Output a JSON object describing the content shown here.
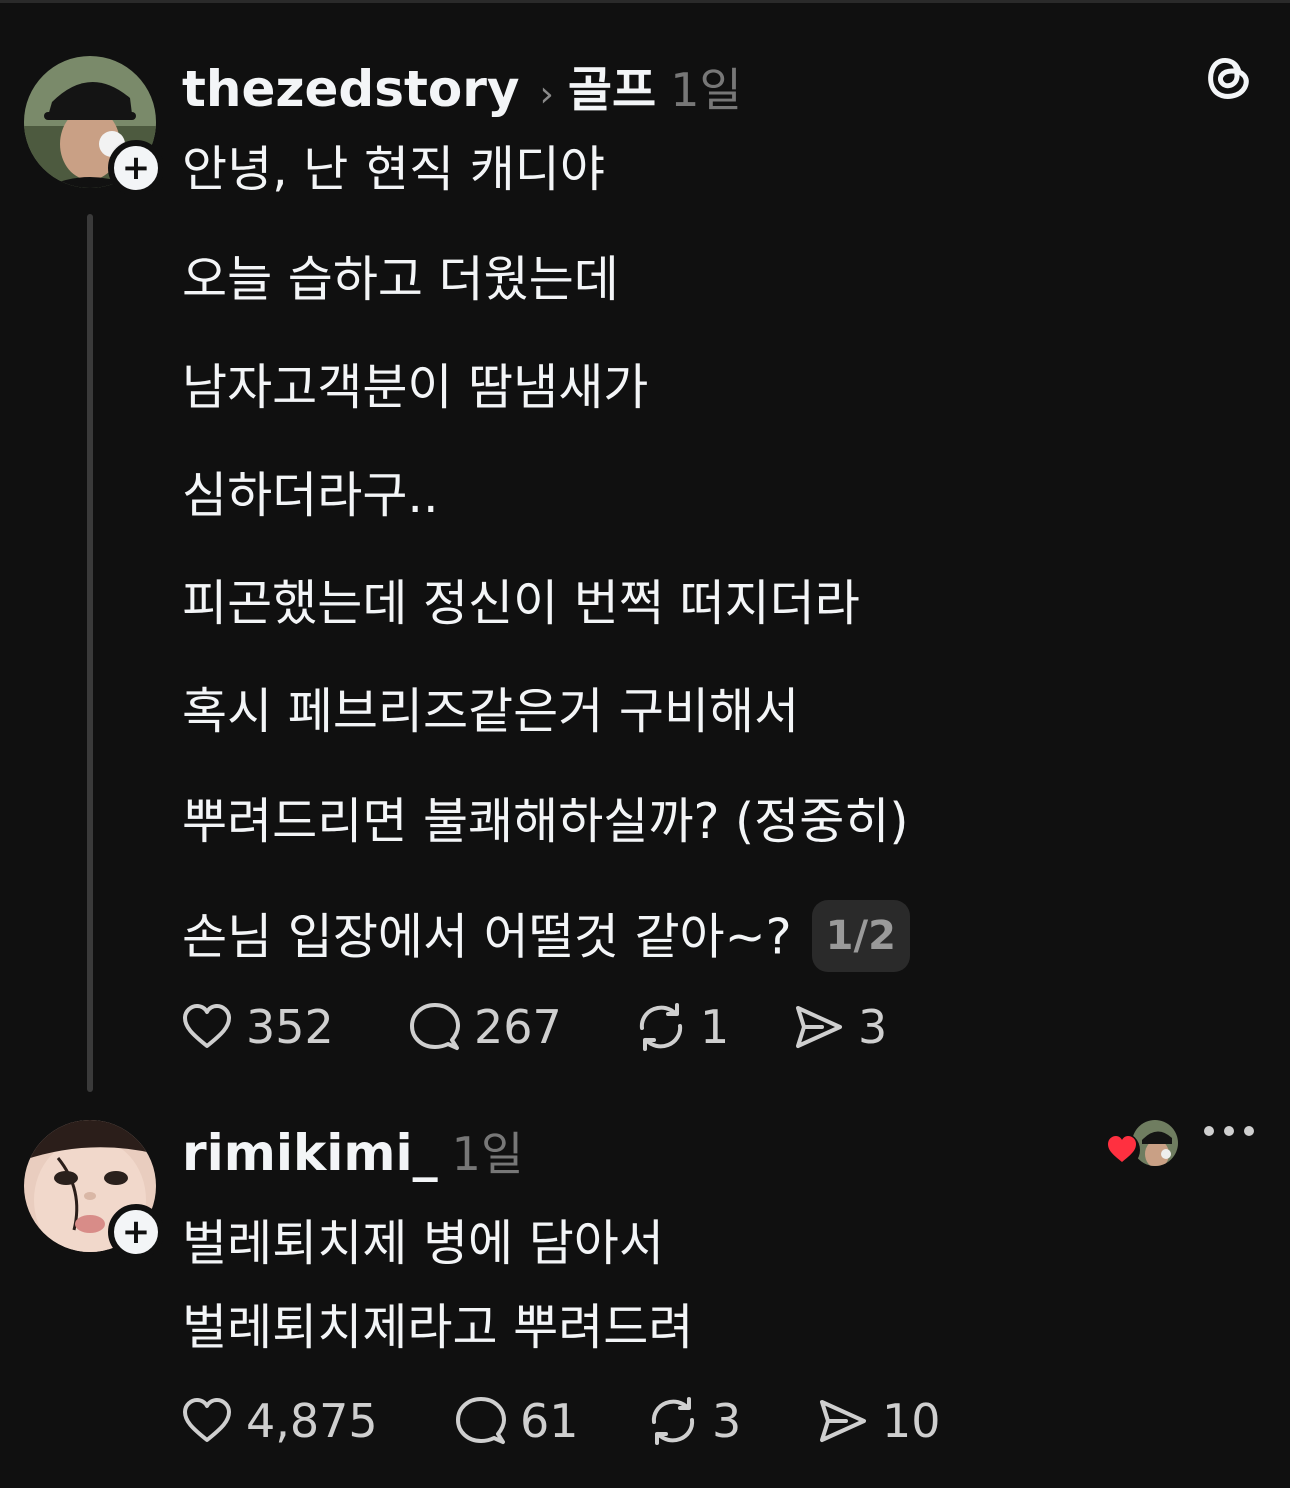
{
  "post1": {
    "username": "thezedstory",
    "topic": "골프",
    "time": "1일",
    "lines": [
      "안녕, 난 현직 캐디야",
      "오늘 습하고 더웠는데",
      "남자고객분이 땀냄새가",
      "심하더라구..",
      "피곤했는데 정신이 번쩍 떠지더라",
      "혹시 페브리즈같은거 구비해서",
      "뿌려드리면 불쾌해하실까? (정중히)",
      "손님 입장에서 어떨것 같아~?"
    ],
    "page_indicator": "1/2",
    "likes": "352",
    "replies": "267",
    "reposts": "1",
    "shares": "3"
  },
  "post2": {
    "username": "rimikimi_",
    "time": "1일",
    "lines": [
      "벌레퇴치제 병에 담아서",
      "벌레퇴치제라고 뿌려드려"
    ],
    "likes": "4,875",
    "replies": "61",
    "reposts": "3",
    "shares": "10"
  },
  "icons": {
    "follow": "+",
    "app_logo": "threads-logo-icon",
    "heart": "heart-icon",
    "reply": "comment-icon",
    "repost": "repost-icon",
    "share": "send-icon",
    "more": "more-dots-icon"
  },
  "colors": {
    "background": "#101010",
    "text": "#f3f5f7",
    "muted": "#777777",
    "like_badge": "#ff3040"
  }
}
